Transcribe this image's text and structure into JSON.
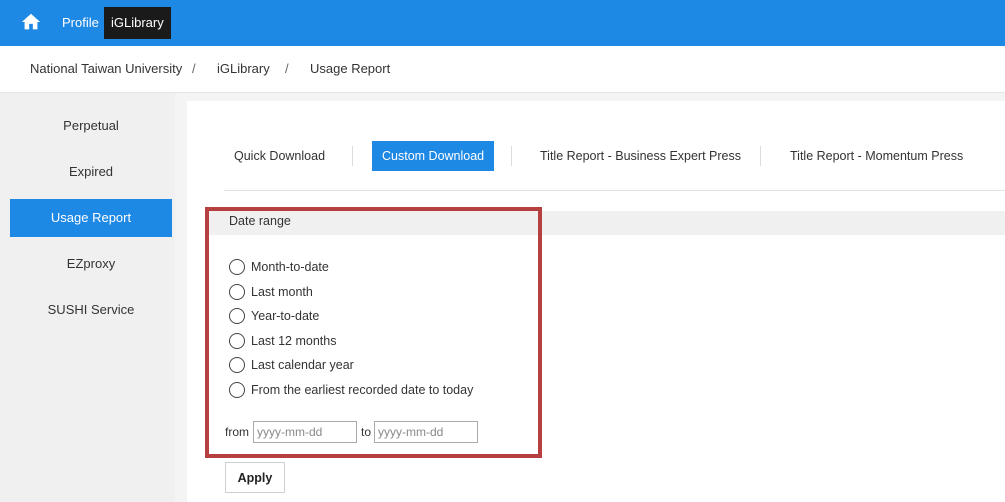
{
  "navbar": {
    "home_icon": "home-icon",
    "profile_label": "Profile",
    "iglibrary_label": "iGLibrary",
    "bg_color": "#1e88e5"
  },
  "breadcrumb": {
    "items": [
      "National Taiwan University",
      "iGLibrary",
      "Usage Report"
    ],
    "separator": "/"
  },
  "sidebar": {
    "items": [
      {
        "label": "Perpetual",
        "active": false
      },
      {
        "label": "Expired",
        "active": false
      },
      {
        "label": "Usage Report",
        "active": true
      },
      {
        "label": "EZproxy",
        "active": false
      },
      {
        "label": "SUSHI Service",
        "active": false
      }
    ]
  },
  "tabs": [
    {
      "label": "Quick Download",
      "active": false
    },
    {
      "label": "Custom Download",
      "active": true
    },
    {
      "label": "Title Report - Business Expert Press",
      "active": false
    },
    {
      "label": "Title Report - Momentum Press",
      "active": false
    }
  ],
  "date_range": {
    "title": "Date range",
    "options": [
      "Month-to-date",
      "Last month",
      "Year-to-date",
      "Last 12 months",
      "Last calendar year",
      "From the earliest recorded date to today"
    ],
    "from_label": "from",
    "to_label": "to",
    "from_placeholder": "yyyy-mm-dd",
    "to_placeholder": "yyyy-mm-dd"
  },
  "apply_label": "Apply",
  "highlight_color": "#b5403f"
}
